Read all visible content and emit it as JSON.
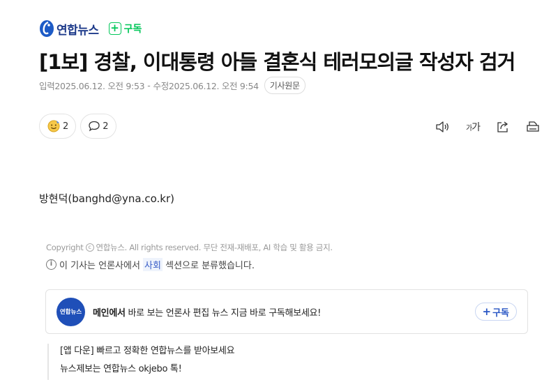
{
  "press": {
    "name": "연합뉴스",
    "subscribe_label": "구독",
    "subscribe_plus": "+",
    "brand_color": "#1d3a8a",
    "subscribe_color": "#03c75a"
  },
  "article": {
    "headline": "[1보] 경찰, 이대통령 아들 결혼식 테러모의글 작성자 검거",
    "input_label": "입력",
    "input_datetime": "2025.06.12. 오전 9:53",
    "meta_separator": "-",
    "modified_label": "수정",
    "modified_datetime": "2025.06.12. 오전 9:54",
    "original_button": "기사원문",
    "reporter": "방현덕(banghd@yna.co.kr)"
  },
  "reactions": {
    "emoji_count": "2",
    "comment_count": "2"
  },
  "tools": {
    "font_small": "가",
    "font_large": "가"
  },
  "footer": {
    "copyright_prefix": "Copyright",
    "copyright_symbol": "c",
    "copyright_text": "연합뉴스. All rights reserved. 무단 전재-재배포, AI 학습 및 활용 금지.",
    "info_symbol": "i",
    "section_note_before": "이 기사는 언론사에서",
    "section_name": "사회",
    "section_note_after": "섹션으로 분류했습니다."
  },
  "subscribe_box": {
    "logo_text": "연합뉴스",
    "promo_bold": "메인에서",
    "promo_rest": "바로 보는 언론사 편집 뉴스 지금 바로 구독해보세요!",
    "button_plus": "+",
    "button_label": "구독",
    "accent_color": "#2755c4"
  },
  "bottom_links": [
    "[앱 다운] 빠르고 정확한 연합뉴스를 받아보세요",
    "뉴스제보는 연합뉴스 okjebo 톡!"
  ],
  "icons": {
    "press_logo": "yonhap-logo-icon",
    "emoji": "smiley-face-icon",
    "comment": "speech-bubble-icon",
    "speaker": "speaker-icon",
    "share": "share-icon",
    "print": "print-icon",
    "info": "info-icon"
  }
}
